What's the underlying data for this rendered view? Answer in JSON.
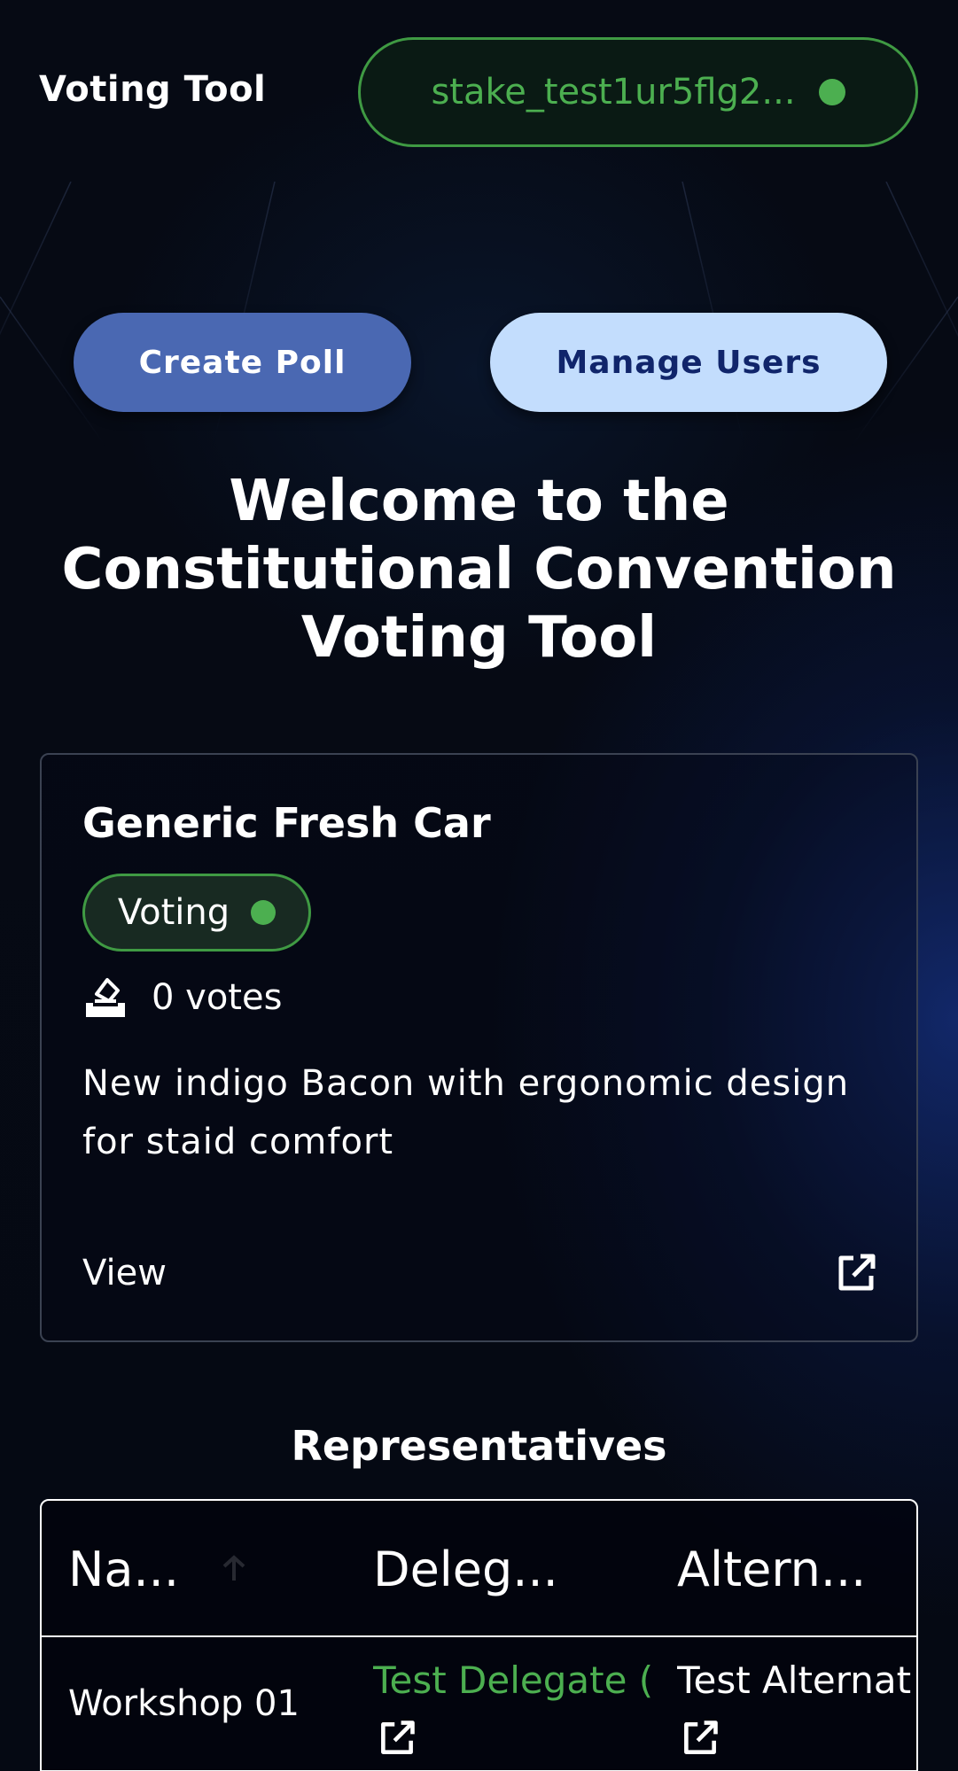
{
  "header": {
    "app_title": "Voting Tool",
    "wallet_address": "stake_test1ur5flg2...",
    "wallet_status_color": "#4caf50"
  },
  "actions": {
    "create_poll": "Create Poll",
    "manage_users": "Manage Users"
  },
  "welcome": {
    "line1": "Welcome to the",
    "line2": "Constitutional Convention",
    "line3": "Voting Tool"
  },
  "poll": {
    "title": "Generic Fresh Car",
    "status": "Voting",
    "votes": "0 votes",
    "description": "New indigo Bacon with ergonomic design for staid comfort",
    "view_label": "View",
    "vote_icon": "ballot-box-icon",
    "link_icon": "external-link-icon"
  },
  "representatives": {
    "heading": "Representatives",
    "columns": [
      "Na...",
      "Deleg...",
      "Altern..."
    ],
    "rows": [
      {
        "name": "Workshop 01",
        "delegate": "Test Delegate (",
        "alternate": "Test Alternat"
      }
    ]
  },
  "colors": {
    "accent_green": "#4caf50",
    "primary_button": "#4a68b2",
    "secondary_button": "#c3ddfd",
    "secondary_button_text": "#10256b"
  }
}
